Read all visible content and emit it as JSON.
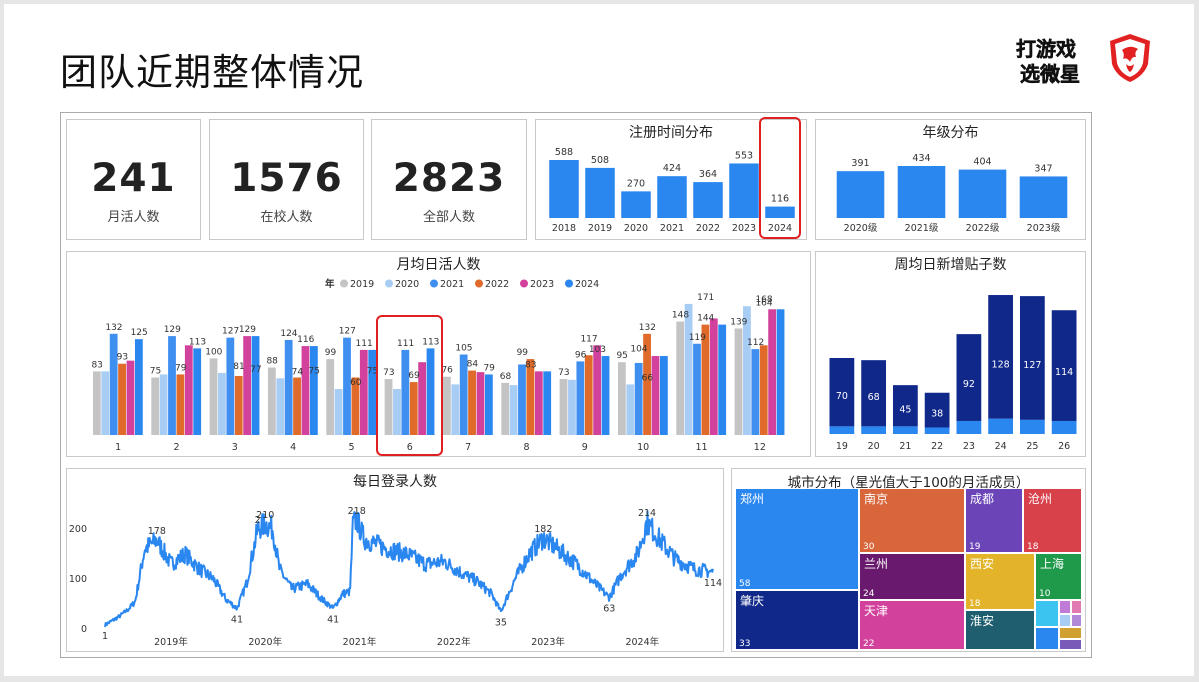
{
  "page": {
    "title": "团队近期整体情况",
    "logo_text": [
      "打游戏",
      "选微星"
    ]
  },
  "kpis": [
    {
      "value": "241",
      "label": "月活人数"
    },
    {
      "value": "1576",
      "label": "在校人数"
    },
    {
      "value": "2823",
      "label": "全部人数"
    }
  ],
  "colors": {
    "blue": "#2b87f0",
    "navy": "#10288a",
    "y2019": "#c4c4c4",
    "y2020": "#a8cdf5",
    "y2021": "#3f8ff0",
    "y2022": "#e06a2a",
    "y2023": "#d2429c",
    "y2024": "#2b87f0"
  },
  "chart_data": [
    {
      "id": "reg",
      "type": "bar",
      "title": "注册时间分布",
      "categories": [
        "2018",
        "2019",
        "2020",
        "2021",
        "2022",
        "2023",
        "2024"
      ],
      "values": [
        588,
        508,
        270,
        424,
        364,
        553,
        116
      ],
      "highlight": "2024"
    },
    {
      "id": "grade",
      "type": "bar",
      "title": "年级分布",
      "categories": [
        "2020级",
        "2021级",
        "2022级",
        "2023级"
      ],
      "values": [
        391,
        434,
        404,
        347
      ]
    },
    {
      "id": "monthly",
      "type": "bar",
      "title": "月均日活人数",
      "legend_title": "年",
      "legend_position": "top",
      "categories": [
        "1",
        "2",
        "3",
        "4",
        "5",
        "6",
        "7",
        "8",
        "9",
        "10",
        "11",
        "12"
      ],
      "series": [
        {
          "name": "2019",
          "values": [
            83,
            75,
            100,
            88,
            99,
            73,
            76,
            68,
            73,
            95,
            148,
            139
          ]
        },
        {
          "name": "2020",
          "values": [
            83,
            79,
            81,
            74,
            60,
            60,
            66,
            65,
            72,
            66,
            171,
            168
          ]
        },
        {
          "name": "2021",
          "values": [
            132,
            129,
            127,
            124,
            127,
            111,
            105,
            92,
            96,
            94,
            119,
            112
          ]
        },
        {
          "name": "2022",
          "values": [
            93,
            79,
            77,
            75,
            75,
            69,
            84,
            99,
            104,
            132,
            144,
            117
          ]
        },
        {
          "name": "2023",
          "values": [
            97,
            117,
            129,
            116,
            111,
            95,
            82,
            83,
            117,
            103,
            152,
            164
          ]
        },
        {
          "name": "2024",
          "values": [
            125,
            113,
            129,
            116,
            111,
            113,
            79,
            83,
            103,
            103,
            144,
            164
          ]
        }
      ],
      "label_series": [
        {
          "series": "2019",
          "months": [
            1,
            2,
            3,
            4,
            5,
            6,
            7,
            8,
            9,
            10,
            11,
            12
          ]
        },
        {
          "series": "2020",
          "months": []
        },
        {
          "series": "2021",
          "months": [
            1,
            2,
            3,
            4,
            5,
            6,
            7,
            8,
            9
          ]
        },
        {
          "series": "2022",
          "months": [
            1,
            2,
            3,
            4,
            5,
            6,
            7,
            8,
            9,
            10,
            11,
            12
          ]
        },
        {
          "series": "2023",
          "months": [
            9
          ]
        },
        {
          "series": "2024",
          "months": [
            1,
            2,
            3,
            4,
            5,
            6,
            7,
            8
          ]
        }
      ],
      "label_values": {
        "1": [
          "83",
          "132",
          "93",
          "125"
        ],
        "2": [
          "75",
          "129",
          "79",
          "113"
        ],
        "3": [
          "100",
          "127",
          "81",
          "77",
          "129"
        ],
        "4": [
          "88",
          "124",
          "74",
          "75",
          "116"
        ],
        "5": [
          "99",
          "127",
          "60",
          "75",
          "111"
        ],
        "6": [
          "73",
          "111",
          "69",
          "113"
        ],
        "7": [
          "76",
          "105",
          "84",
          "79"
        ],
        "8": [
          "68",
          "99",
          "83"
        ],
        "9": [
          "73",
          "96",
          "117",
          "103"
        ],
        "10": [
          "95",
          "66",
          "104",
          "132"
        ],
        "11": [
          "148",
          "171",
          "119",
          "144"
        ],
        "12": [
          "139",
          "168",
          "112",
          "164"
        ]
      },
      "highlight": "6"
    },
    {
      "id": "weekly",
      "type": "bar",
      "title": "周均日新增贴子数",
      "categories": [
        "19",
        "20",
        "21",
        "22",
        "23",
        "24",
        "25",
        "26"
      ],
      "values": [
        70,
        68,
        45,
        38,
        92,
        128,
        127,
        114
      ],
      "base_values": [
        7,
        7,
        7,
        6,
        12,
        14,
        13,
        12
      ]
    },
    {
      "id": "daily",
      "type": "line",
      "title": "每日登录人数",
      "yticks": [
        0,
        100,
        200
      ],
      "ylim": [
        0,
        240
      ],
      "xticks": [
        "2019年",
        "2020年",
        "2021年",
        "2022年",
        "2023年",
        "2024年"
      ],
      "x_start": 2018.3,
      "x_end": 2024.75,
      "anchors": [
        [
          2018.3,
          8
        ],
        [
          2018.45,
          25
        ],
        [
          2018.55,
          40
        ],
        [
          2018.62,
          55
        ],
        [
          2018.72,
          160
        ],
        [
          2018.85,
          178
        ],
        [
          2019.0,
          130
        ],
        [
          2019.15,
          150
        ],
        [
          2019.3,
          120
        ],
        [
          2019.45,
          100
        ],
        [
          2019.58,
          60
        ],
        [
          2019.7,
          41
        ],
        [
          2019.8,
          90
        ],
        [
          2019.92,
          200
        ],
        [
          2020.0,
          210
        ],
        [
          2020.08,
          200
        ],
        [
          2020.15,
          120
        ],
        [
          2020.28,
          80
        ],
        [
          2020.45,
          90
        ],
        [
          2020.6,
          60
        ],
        [
          2020.72,
          41
        ],
        [
          2020.82,
          70
        ],
        [
          2020.9,
          75
        ],
        [
          2020.93,
          210
        ],
        [
          2020.97,
          218
        ],
        [
          2021.05,
          180
        ],
        [
          2021.3,
          160
        ],
        [
          2021.5,
          150
        ],
        [
          2021.7,
          130
        ],
        [
          2021.9,
          135
        ],
        [
          2022.1,
          110
        ],
        [
          2022.25,
          95
        ],
        [
          2022.4,
          70
        ],
        [
          2022.5,
          35
        ],
        [
          2022.65,
          100
        ],
        [
          2022.8,
          150
        ],
        [
          2022.95,
          182
        ],
        [
          2023.1,
          160
        ],
        [
          2023.3,
          130
        ],
        [
          2023.5,
          90
        ],
        [
          2023.65,
          63
        ],
        [
          2023.78,
          110
        ],
        [
          2023.95,
          150
        ],
        [
          2024.05,
          214
        ],
        [
          2024.2,
          175
        ],
        [
          2024.35,
          140
        ],
        [
          2024.55,
          120
        ],
        [
          2024.75,
          114
        ]
      ],
      "labels": [
        {
          "t": "178",
          "x": 2018.85,
          "y": 178
        },
        {
          "t": "41",
          "x": 2019.7,
          "y": 41
        },
        {
          "t": "210",
          "x": 2020.0,
          "y": 210
        },
        {
          "t": "2",
          "x": 2019.92,
          "y": 200
        },
        {
          "t": "41",
          "x": 2020.72,
          "y": 41
        },
        {
          "t": "218",
          "x": 2020.97,
          "y": 218
        },
        {
          "t": "35",
          "x": 2022.5,
          "y": 35
        },
        {
          "t": "182",
          "x": 2022.95,
          "y": 182
        },
        {
          "t": "63",
          "x": 2023.65,
          "y": 63
        },
        {
          "t": "214",
          "x": 2024.05,
          "y": 214
        },
        {
          "t": "114",
          "x": 2024.75,
          "y": 114
        },
        {
          "t": "1",
          "x": 2018.3,
          "y": 8
        }
      ]
    },
    {
      "id": "city",
      "type": "treemap",
      "title": "城市分布（星光值大于100的月活成员）",
      "items": [
        {
          "name": "郑州",
          "value": "58",
          "color": "#2b87f0"
        },
        {
          "name": "肇庆",
          "value": "33",
          "color": "#10288a"
        },
        {
          "name": "南京",
          "value": "30",
          "color": "#d8663a"
        },
        {
          "name": "兰州",
          "value": "24",
          "color": "#6a1a6e"
        },
        {
          "name": "天津",
          "value": "22",
          "color": "#d2429c"
        },
        {
          "name": "成都",
          "value": "19",
          "color": "#6b44b8"
        },
        {
          "name": "沧州",
          "value": "18",
          "color": "#d8404a"
        },
        {
          "name": "西安",
          "value": "18",
          "color": "#e3b42a"
        },
        {
          "name": "淮安",
          "value": "",
          "color": "#1f5e6e"
        },
        {
          "name": "上海",
          "value": "10",
          "color": "#1e9a4a"
        }
      ]
    }
  ]
}
